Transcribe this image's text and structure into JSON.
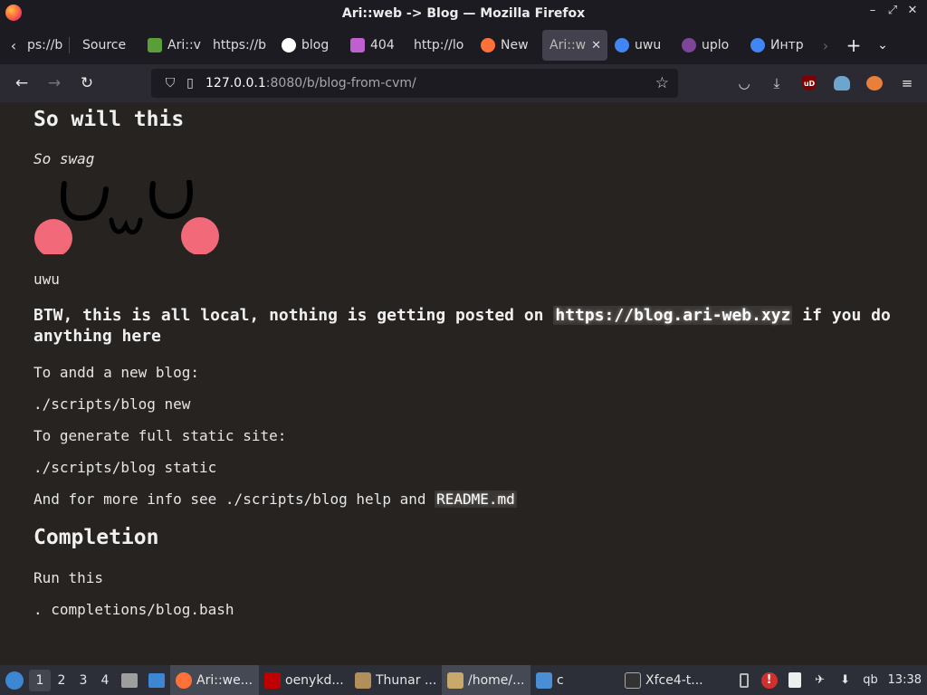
{
  "window": {
    "title": "Ari::web -> Blog — Mozilla Firefox",
    "controls": {
      "minimize": "–",
      "restore": "⤢",
      "close": "✕"
    }
  },
  "tabs": [
    {
      "label": "ps://b",
      "icon": "none"
    },
    {
      "label": "Source",
      "icon": "none"
    },
    {
      "label": "Ari::v",
      "icon": "ari-web-icon",
      "color": "#5a9e3a"
    },
    {
      "label": "https://b",
      "icon": "none"
    },
    {
      "label": "blog",
      "icon": "github-icon",
      "color": "#ffffff"
    },
    {
      "label": "404",
      "icon": "pixel-icon",
      "color": "#c05fd0"
    },
    {
      "label": "http://lo",
      "icon": "none"
    },
    {
      "label": "New",
      "icon": "firefox-icon",
      "color": "#ff7139"
    },
    {
      "label": "Ari::w",
      "icon": "none",
      "active": true,
      "close": "✕"
    },
    {
      "label": "uwu",
      "icon": "google-icon",
      "color": "#4285f4"
    },
    {
      "label": "uplo",
      "icon": "tor-icon",
      "color": "#7d4698"
    },
    {
      "label": "Интр",
      "icon": "google-icon",
      "color": "#4285f4"
    }
  ],
  "tabstrip": {
    "new_tab": "+",
    "list_all": "⌄"
  },
  "navbar": {
    "back": "←",
    "forward": "→",
    "reload": "↻",
    "url_host": "127.0.0.1",
    "url_rest": ":8080/b/blog-from-cvm/",
    "bookmark_star": "☆"
  },
  "extensions": {
    "pocket": "◡",
    "download": "⤓",
    "ublock": "uD",
    "menu": "≡"
  },
  "content": {
    "heading1": "So will this",
    "italic_line": "So swag",
    "uwu_caption": "uwu",
    "btw_prefix": "BTW, this is all local, nothing is getting posted on",
    "btw_link": "https://blog.ari-web.xyz",
    "btw_suffix": " if you do anything here",
    "p_add": "To andd a new blog:",
    "p_add_cmd": "./scripts/blog new",
    "p_gen": "To generate full static site:",
    "p_gen_cmd": "./scripts/blog static",
    "p_info_prefix": "And for more info see ./scripts/blog help and ",
    "p_info_code": "README.md",
    "heading2": "Completion",
    "p_run": "Run this",
    "p_run_cmd": ". completions/blog.bash"
  },
  "taskbar": {
    "workspaces": [
      "1",
      "2",
      "3",
      "4"
    ],
    "active_workspace": "1",
    "tasks": [
      {
        "label": "Ari::we...",
        "color": "#ff7139",
        "active": true
      },
      {
        "label": "oenykd...",
        "color": "#bf0000"
      },
      {
        "label": "Thunar ...",
        "color": "#b08f5a"
      },
      {
        "label": "/home/...",
        "color": "#c8a86b",
        "active": true
      },
      {
        "label": "c",
        "color": "#4a8fd6"
      },
      {
        "label": "Xfce4-t...",
        "color": "#333333"
      }
    ],
    "tray": {
      "alert": "!",
      "qb": "qb",
      "clock": "13:38"
    }
  }
}
